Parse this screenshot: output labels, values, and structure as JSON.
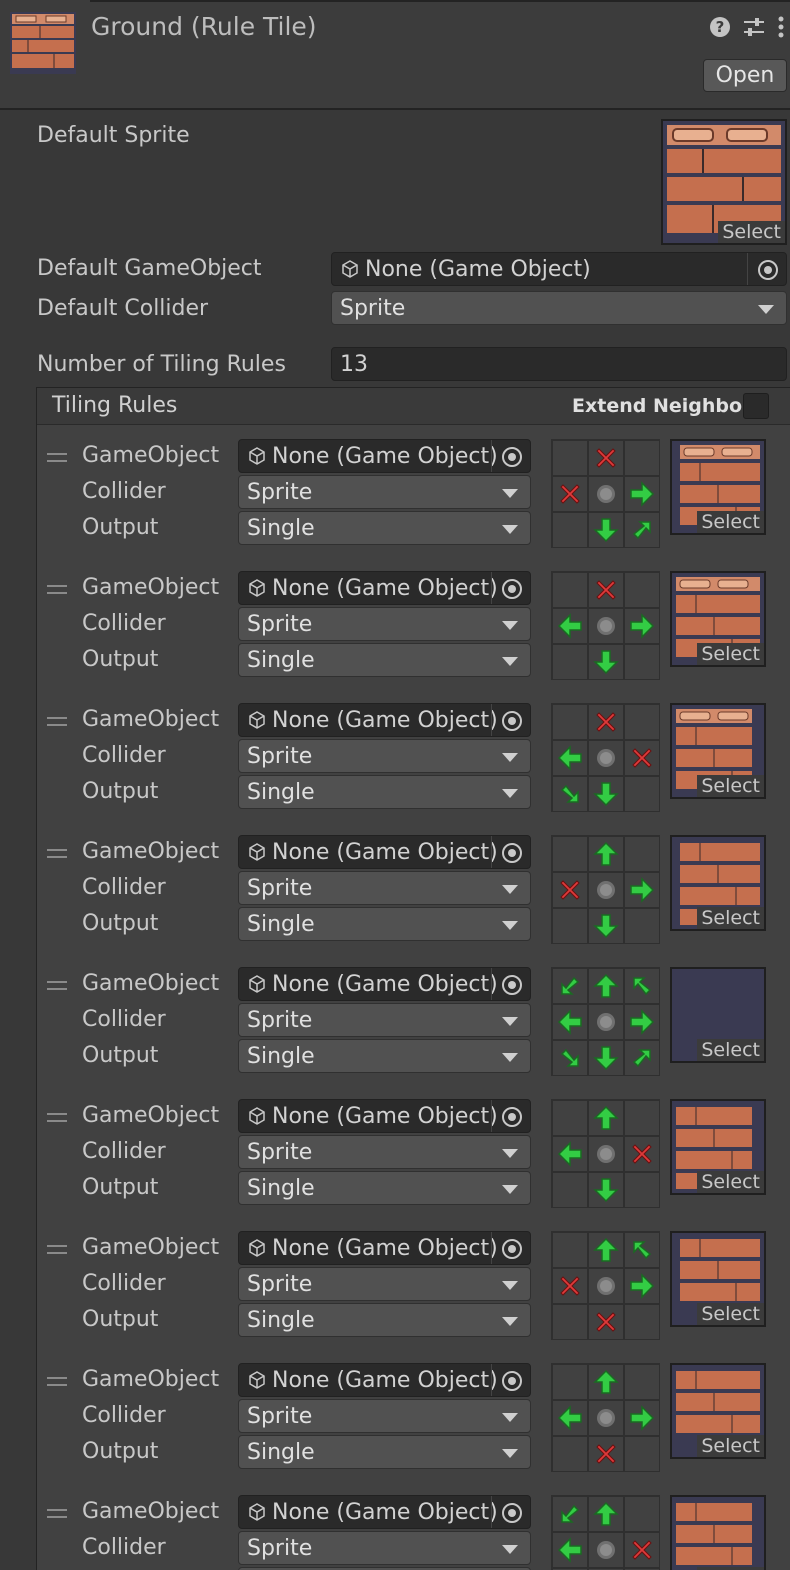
{
  "header": {
    "title": "Ground (Rule Tile)",
    "open_label": "Open",
    "icons": [
      "help-icon",
      "preset-icon",
      "more-icon"
    ]
  },
  "properties": {
    "default_sprite_label": "Default Sprite",
    "default_gameobject_label": "Default GameObject",
    "default_gameobject_value": "None (Game Object)",
    "default_collider_label": "Default Collider",
    "default_collider_value": "Sprite",
    "num_rules_label": "Number of Tiling Rules",
    "num_rules_value": "13",
    "select_label": "Select"
  },
  "tiling_rules": {
    "title": "Tiling Rules",
    "extend_neighbor_label": "Extend Neighbor",
    "gameobject_label": "GameObject",
    "collider_label": "Collider",
    "output_label": "Output",
    "gameobject_value": "None (Game Object)",
    "collider_value": "Sprite",
    "output_value": "Single",
    "select_label": "Select",
    "rules": [
      {
        "grid": [
          "",
          "x",
          "",
          "x",
          "c",
          "r",
          "",
          "d",
          "dr"
        ],
        "sprite": "top-left-corner"
      },
      {
        "grid": [
          "",
          "x",
          "",
          "l",
          "c",
          "r",
          "",
          "d",
          ""
        ],
        "sprite": "top-edge"
      },
      {
        "grid": [
          "",
          "x",
          "",
          "l",
          "c",
          "x",
          "dl",
          "d",
          ""
        ],
        "sprite": "top-right-corner"
      },
      {
        "grid": [
          "",
          "u",
          "",
          "x",
          "c",
          "r",
          "",
          "d",
          ""
        ],
        "sprite": "left-edge"
      },
      {
        "grid": [
          "ul",
          "u",
          "ur",
          "l",
          "c",
          "r",
          "dl",
          "d",
          "dr"
        ],
        "sprite": "fill"
      },
      {
        "grid": [
          "",
          "u",
          "",
          "l",
          "c",
          "x",
          "",
          "d",
          ""
        ],
        "sprite": "right-edge"
      },
      {
        "grid": [
          "",
          "u",
          "ur",
          "x",
          "c",
          "r",
          "",
          "x",
          ""
        ],
        "sprite": "bottom-left-corner"
      },
      {
        "grid": [
          "",
          "u",
          "",
          "l",
          "c",
          "r",
          "",
          "x",
          ""
        ],
        "sprite": "bottom-edge"
      },
      {
        "grid": [
          "ul",
          "u",
          "",
          "l",
          "c",
          "x",
          "",
          "",
          ""
        ],
        "sprite": "bottom-right-corner"
      }
    ]
  }
}
